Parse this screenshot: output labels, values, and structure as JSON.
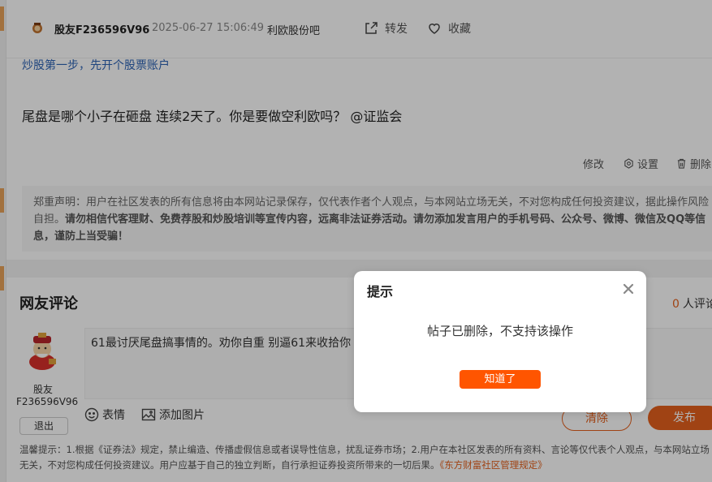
{
  "header": {
    "username": "股友F236596V96",
    "time": "2025-06-27 15:06:49",
    "bar": "利欧股份吧",
    "share_label": "转发",
    "favorite_label": "收藏"
  },
  "promo_link": "炒股第一步，先开个股票账户",
  "post": {
    "content": "尾盘是哪个小子在砸盘  连续2天了。你是要做空利欧吗？ @证监会",
    "edit_label": "修改",
    "settings_label": "设置",
    "delete_label": "删除"
  },
  "disclaimer": {
    "normal": "郑重声明：用户在社区发表的所有信息将由本网站记录保存，仅代表作者个人观点，与本网站立场无关，不对您构成任何投资建议，据此操作风险自担。",
    "bold": "请勿相信代客理财、免费荐股和炒股培训等宣传内容，远离非法证券活动。请勿添加发言用户的手机号码、公众号、微博、微信及QQ等信息，谨防上当受骗！"
  },
  "comments": {
    "title": "网友评论",
    "count": "0",
    "count_suffix": "人评论"
  },
  "me": {
    "name": "股友F236596V96",
    "logout_label": "退出"
  },
  "editor": {
    "text": "61最讨厌尾盘搞事情的。劝你自重  别逼61来收拾你",
    "emoji_label": "表情",
    "image_label": "添加图片",
    "clear_label": "清除",
    "publish_label": "发布"
  },
  "tip": {
    "text": "温馨提示：1.根据《证券法》规定，禁止编造、传播虚假信息或者误导性信息，扰乱证券市场；2.用户在本社区发表的所有资料、言论等仅代表个人观点，与本网站立场无关，不对您构成任何投资建议。用户应基于自己的独立判断，自行承担证券投资所带来的一切后果。",
    "link": "《东方财富社区管理规定》"
  },
  "modal": {
    "title": "提示",
    "message": "帖子已删除，不支持该操作",
    "button": "知道了"
  },
  "colors": {
    "accent": "#e5611e",
    "modal_button": "#ff5500",
    "link": "#2d63b5"
  }
}
